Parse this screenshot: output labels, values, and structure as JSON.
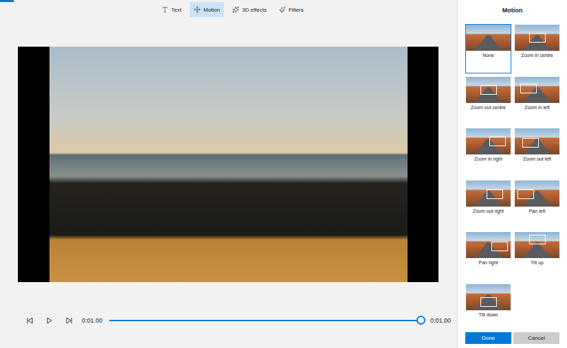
{
  "loading_bar": {
    "level": 0.03
  },
  "toolbar": {
    "tabs": [
      {
        "label": "Text",
        "selected": false
      },
      {
        "label": "Motion",
        "selected": true
      },
      {
        "label": "3D effects",
        "selected": false
      },
      {
        "label": "Filters",
        "selected": false
      }
    ]
  },
  "player": {
    "current": "0:01.00",
    "total": "0:01.00",
    "level": 1
  },
  "panel": {
    "title": "Motion",
    "options": [
      {
        "label": "None",
        "selected": true
      },
      {
        "label": "Zoom in centre",
        "selected": false
      },
      {
        "label": "Zoom out centre",
        "selected": false
      },
      {
        "label": "Zoom in left",
        "selected": false
      },
      {
        "label": "Zoom in right",
        "selected": false
      },
      {
        "label": "Zoom out left",
        "selected": false
      },
      {
        "label": "Zoom out right",
        "selected": false
      },
      {
        "label": "Pan left",
        "selected": false
      },
      {
        "label": "Pan right",
        "selected": false
      },
      {
        "label": "Tilt up",
        "selected": false
      },
      {
        "label": "Tilt down",
        "selected": false
      }
    ],
    "buttons": [
      {
        "label": "Done",
        "primary": true
      },
      {
        "label": "Cancel",
        "primary": false
      }
    ]
  }
}
